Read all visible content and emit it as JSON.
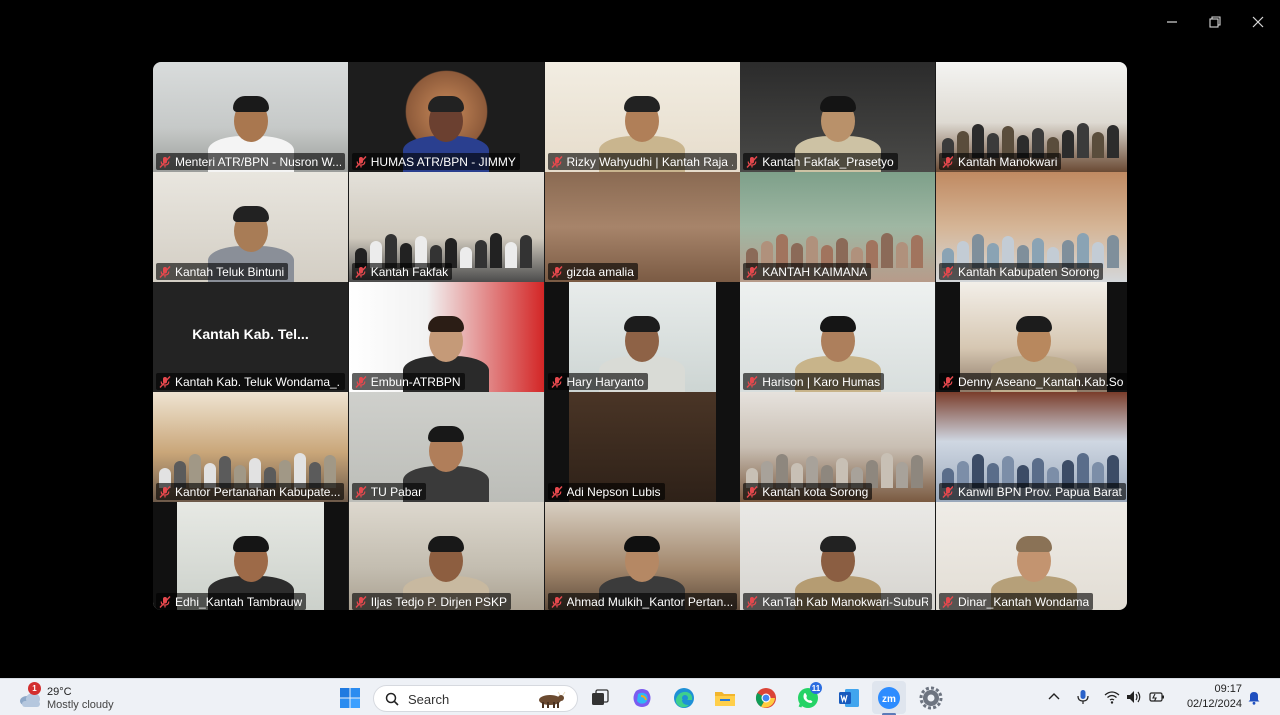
{
  "window": {
    "controls": [
      "minimize-icon",
      "restore-icon",
      "close-icon"
    ]
  },
  "participants": [
    {
      "name": "Menteri ATR/BPN - Nusron W...",
      "muted": true,
      "tone": "office-white"
    },
    {
      "name": "HUMAS ATR/BPN - JIMMY",
      "muted": true,
      "tone": "basketball"
    },
    {
      "name": "Rizky Wahyudhi | Kantah Raja ...",
      "muted": true,
      "tone": "uniform-cream"
    },
    {
      "name": "Kantah Fakfak_Prasetyo",
      "muted": true,
      "tone": "dark-office"
    },
    {
      "name": "Kantah Manokwari",
      "muted": true,
      "tone": "meeting-room"
    },
    {
      "name": "Kantah Teluk Bintuni",
      "muted": true,
      "tone": "office-desk"
    },
    {
      "name": "Kantah Fakfak",
      "muted": true,
      "tone": "meeting-hall"
    },
    {
      "name": "gizda amalia",
      "muted": true,
      "tone": "wood-ceiling"
    },
    {
      "name": "KANTAH KAIMANA",
      "muted": true,
      "tone": "crowd-green"
    },
    {
      "name": "Kantah Kabupaten Sorong",
      "muted": true,
      "tone": "crowd-hall"
    },
    {
      "name": "Kantah Kab. Teluk Wondama_...",
      "muted": true,
      "tone": "avatar",
      "avatar_text": "Kantah Kab. Tel..."
    },
    {
      "name": "Embun-ATRBPN",
      "muted": true,
      "tone": "red-backdrop"
    },
    {
      "name": "Hary Haryanto",
      "muted": true,
      "tone": "pillar-light"
    },
    {
      "name": "Harison | Karo Humas",
      "muted": true,
      "tone": "speaker",
      "active": true
    },
    {
      "name": "Denny Aseano_Kantah.Kab.Sor",
      "muted": true,
      "tone": "pillar-room"
    },
    {
      "name": "Kantor Pertanahan Kabupate...",
      "muted": true,
      "tone": "hall-wood"
    },
    {
      "name": "TU Pabar",
      "muted": true,
      "tone": "blur-light"
    },
    {
      "name": "Adi Nepson Lubis",
      "muted": true,
      "tone": "pillar-dark"
    },
    {
      "name": "Kantah kota Sorong",
      "muted": true,
      "tone": "conference-table"
    },
    {
      "name": "Kanwil BPN Prov. Papua Barat",
      "muted": true,
      "tone": "banner-room"
    },
    {
      "name": "Edhi_Kantah Tambrauw",
      "muted": true,
      "tone": "pillar-glasses"
    },
    {
      "name": "Iljas Tedjo P. Dirjen PSKP",
      "muted": true,
      "tone": "office-chair"
    },
    {
      "name": "Ahmad Mulkih_Kantor Pertan...",
      "muted": true,
      "tone": "peci-man"
    },
    {
      "name": "KanTah Kab Manokwari-SubuR",
      "muted": true,
      "tone": "wall-text"
    },
    {
      "name": "Dinar_Kantah Wondama",
      "muted": true,
      "tone": "hijab-woman"
    }
  ],
  "taskbar": {
    "weather": {
      "temp": "29°C",
      "condition": "Mostly cloudy",
      "badge": "1"
    },
    "search_placeholder": "Search",
    "whatsapp_badge": "11",
    "time": "09:17",
    "date": "02/12/2024"
  },
  "colors": {
    "active_speaker": "#23d962",
    "muted_mic": "#e5484d",
    "taskbar_bg": "#eef1f6",
    "window_bg": "#000000"
  }
}
